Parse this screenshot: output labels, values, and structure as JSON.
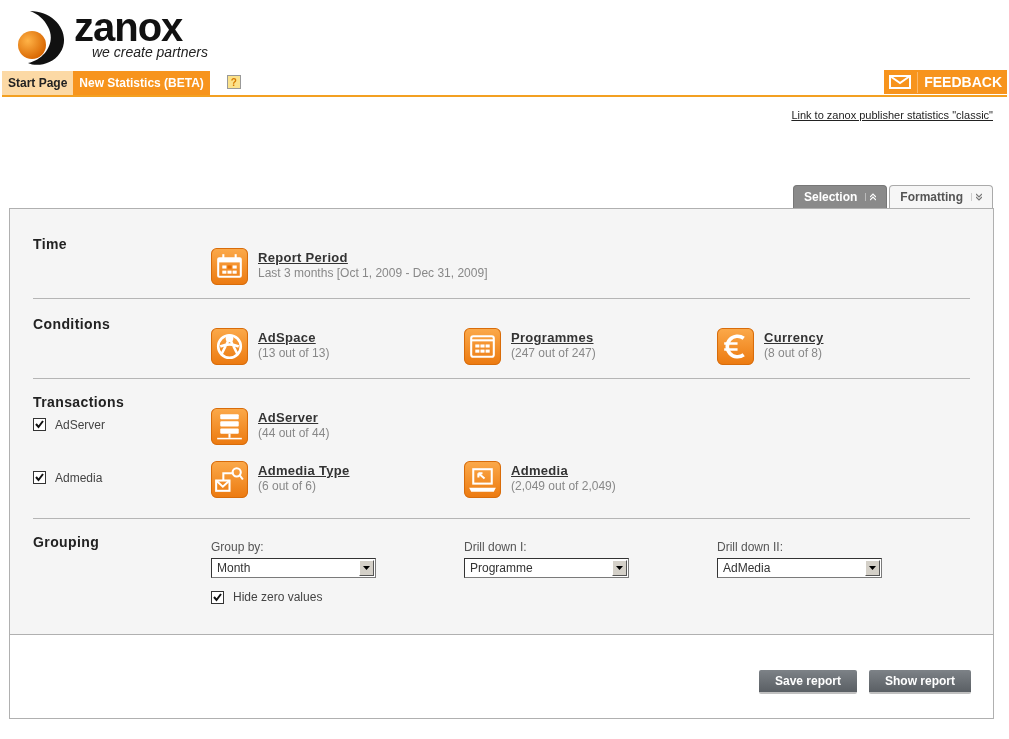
{
  "logo": {
    "name": "zanox",
    "tagline": "we create partners"
  },
  "nav": {
    "tabs": [
      {
        "label": "Start Page",
        "selected": false
      },
      {
        "label": "New Statistics (BETA)",
        "selected": true
      }
    ],
    "help": "?",
    "feedback": "FEEDBACK"
  },
  "classic_link": "Link to zanox publisher statistics \"classic\"",
  "panel_tabs": [
    {
      "label": "Selection",
      "selected": true
    },
    {
      "label": "Formatting",
      "selected": false
    }
  ],
  "sections": [
    {
      "kind": "items",
      "title": "Time",
      "items": [
        {
          "kind": "calendar",
          "label": "Report Period",
          "detail": "Last 3 months [Oct 1, 2009 - Dec 31, 2009]"
        }
      ]
    },
    {
      "kind": "items",
      "title": "Conditions",
      "items": [
        {
          "kind": "globe",
          "label": "AdSpace",
          "detail": "(13 out of 13)"
        },
        {
          "kind": "grid",
          "label": "Programmes",
          "detail": "(247 out of 247)"
        },
        {
          "kind": "euro",
          "label": "Currency",
          "detail": "(8 out of 8)"
        }
      ]
    },
    {
      "kind": "transactions",
      "title": "Transactions",
      "rows": [
        {
          "label": "AdServer",
          "checked": true,
          "items": [
            {
              "kind": "server",
              "label": "AdServer",
              "detail": "(44 out of 44)"
            }
          ]
        },
        {
          "label": "Admedia",
          "checked": true,
          "items": [
            {
              "kind": "mailsearch",
              "label": "Admedia Type",
              "detail": "(6 out of 6)"
            },
            {
              "kind": "laptop",
              "label": "Admedia",
              "detail": "(2,049 out of 2,049)"
            }
          ]
        }
      ]
    },
    {
      "kind": "grouping",
      "title": "Grouping",
      "selects": [
        {
          "label": "Group by:",
          "value": "Month"
        },
        {
          "label": "Drill down I:",
          "value": "Programme"
        },
        {
          "label": "Drill down II:",
          "value": "AdMedia"
        }
      ],
      "hide_zero": {
        "label": "Hide zero values",
        "checked": true
      }
    }
  ],
  "buttons": [
    "Save report",
    "Show report"
  ]
}
